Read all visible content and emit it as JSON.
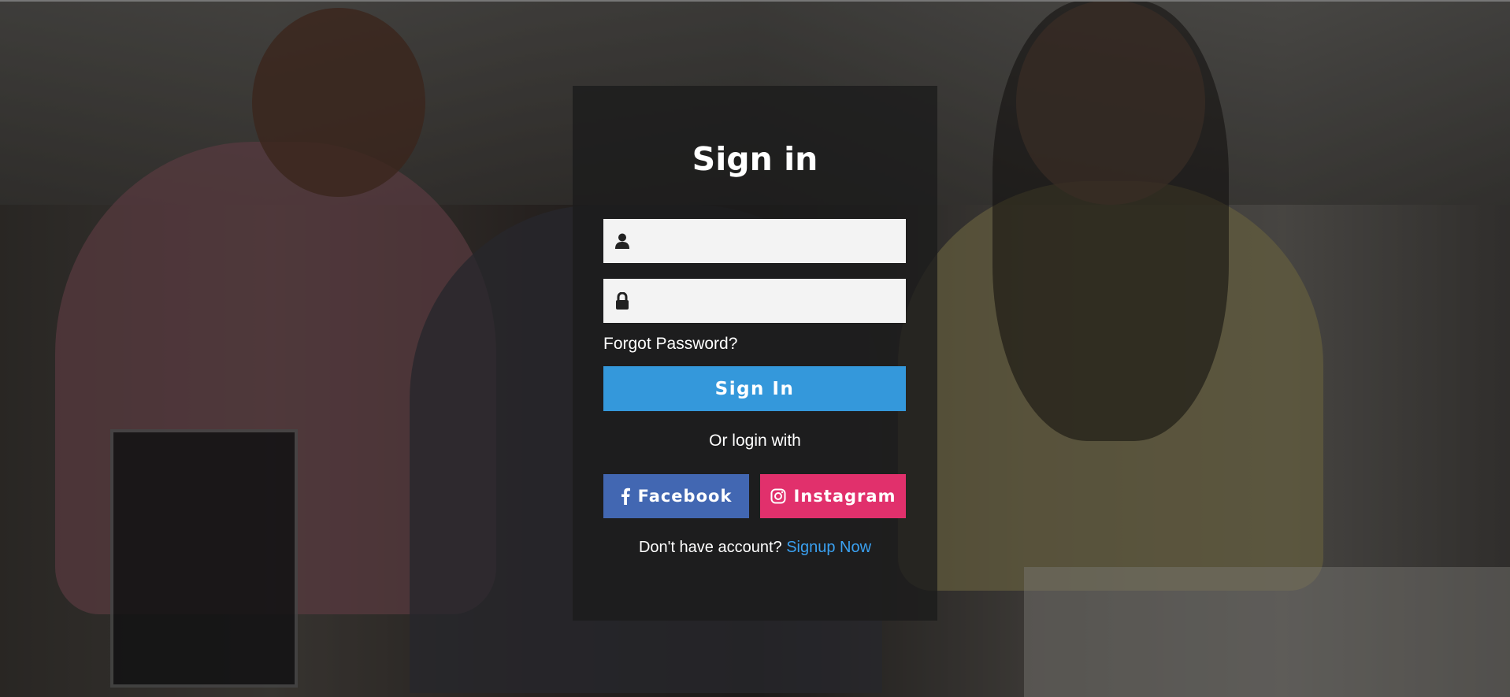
{
  "colors": {
    "primary_button": "#3498db",
    "facebook": "#4267b2",
    "instagram": "#e1306c",
    "link": "#3aa0f0",
    "card_background": "rgba(28,28,28,0.82)"
  },
  "signin": {
    "title": "Sign in",
    "username_field": {
      "icon": "user-icon",
      "value": "",
      "placeholder": ""
    },
    "password_field": {
      "icon": "lock-icon",
      "value": "",
      "placeholder": ""
    },
    "forgot_password": "Forgot Password?",
    "submit_label": "Sign In",
    "alternative_text": "Or login with",
    "social": [
      {
        "label": "Facebook",
        "icon": "facebook-icon"
      },
      {
        "label": "Instagram",
        "icon": "instagram-icon"
      }
    ],
    "signup_prompt": "Don't have account?",
    "signup_link": "Signup Now"
  }
}
